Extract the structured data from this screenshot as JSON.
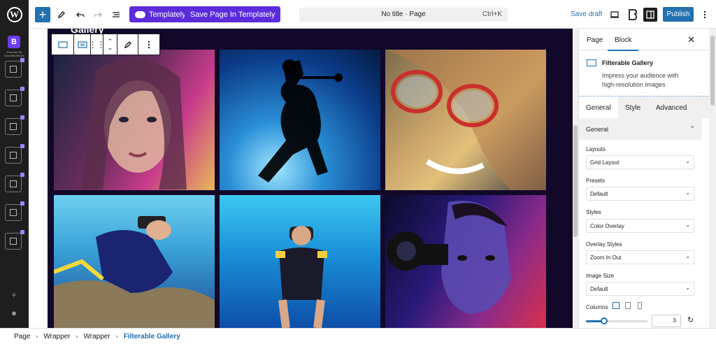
{
  "topbar": {
    "templately_label": "Templately",
    "save_templately_label": "Save Page In Templately",
    "doc_title": "No title · Page",
    "shortcut": "Ctrl+K",
    "save_draft": "Save draft",
    "publish": "Publish"
  },
  "sidebar": {
    "brand_text": "Powered By Essential Blocks"
  },
  "canvas": {
    "gallery_title": "Gallery"
  },
  "panel": {
    "tabs": [
      "Page",
      "Block"
    ],
    "active_tab": "Block",
    "block_title": "Filterable Gallery",
    "block_desc": "Impress your audience with high-resolution images",
    "sub_tabs": [
      "General",
      "Style",
      "Advanced"
    ],
    "section_title": "General",
    "fields": [
      {
        "label": "Layouts",
        "value": "Grid Layout"
      },
      {
        "label": "Presets",
        "value": "Default"
      },
      {
        "label": "Styles",
        "value": "Color Overlay"
      },
      {
        "label": "Overlay Styles",
        "value": "Zoom In Out"
      },
      {
        "label": "Image Size",
        "value": "Default"
      }
    ],
    "columns_label": "Columns",
    "columns_value": "3"
  },
  "breadcrumb": [
    "Page",
    "Wrapper",
    "Wrapper",
    "Filterable Gallery"
  ],
  "colors": {
    "accent": "#2271b1",
    "templately": "#5c2bdc",
    "dark": "#1e1e1e"
  }
}
